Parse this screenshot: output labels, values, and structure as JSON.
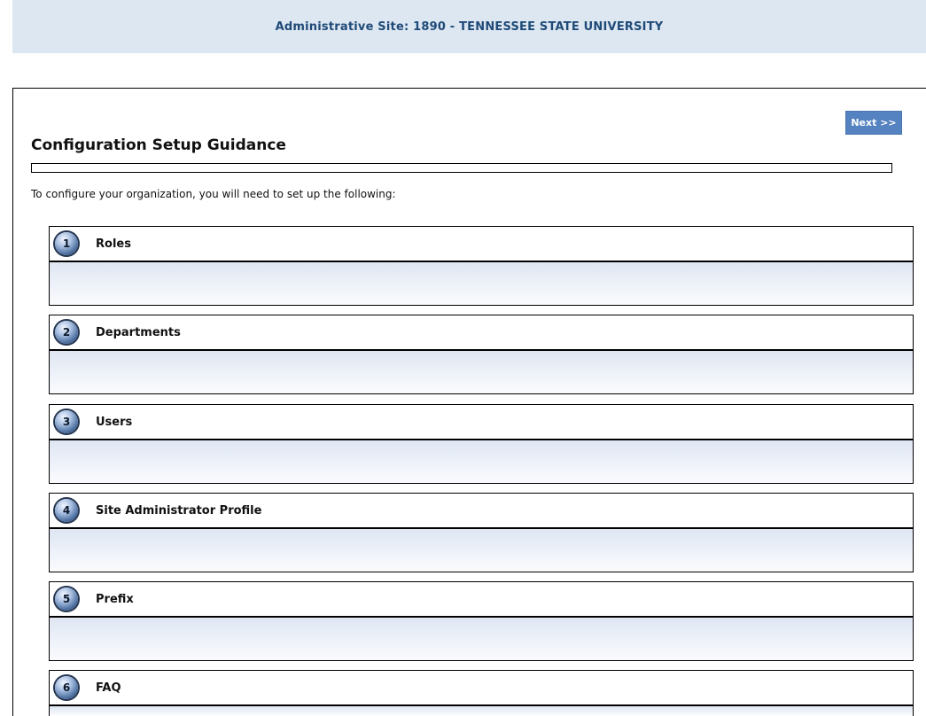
{
  "header": {
    "site_title": "Administrative Site: 1890 - TENNESSEE STATE UNIVERSITY"
  },
  "guidance": {
    "title": "Configuration Setup Guidance",
    "intro": "To configure your organization, you will need to set up the following:",
    "next_label": "Next >>"
  },
  "steps": [
    {
      "number": "1",
      "label": "Roles"
    },
    {
      "number": "2",
      "label": "Departments"
    },
    {
      "number": "3",
      "label": "Users"
    },
    {
      "number": "4",
      "label": "Site Administrator Profile"
    },
    {
      "number": "5",
      "label": "Prefix"
    },
    {
      "number": "6",
      "label": "FAQ"
    }
  ],
  "colors": {
    "header_band": "#dde7f1",
    "header_text": "#1f4a78",
    "button": "#5583c1"
  }
}
